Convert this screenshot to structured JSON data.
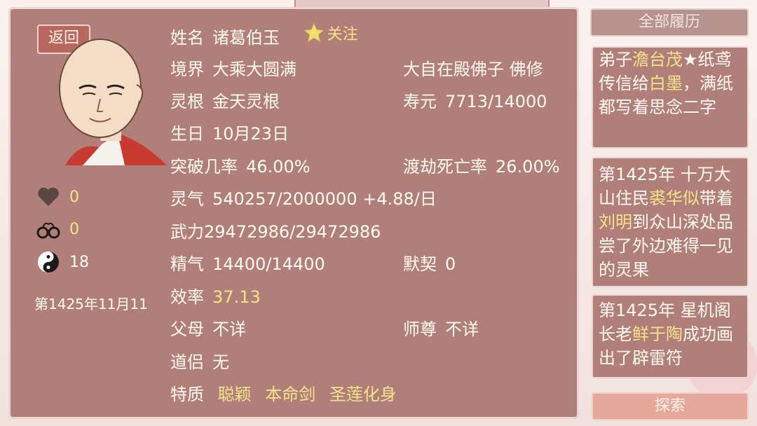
{
  "back_label": "返回",
  "portrait_alt": "",
  "stats": {
    "favor": "0",
    "bond": "0",
    "dao": "18"
  },
  "current_date": "第1425年11月11",
  "info": {
    "name_label": "姓名",
    "name_value": "诸葛伯玉",
    "follow_label": "关注",
    "realm_label": "境界",
    "realm_value": "大乘大圆满",
    "title_value": "大自在殿佛子  佛修",
    "root_label": "灵根",
    "root_value": "金天灵根",
    "lifespan_label": "寿元",
    "lifespan_value": "7713/14000",
    "birthday_label": "生日",
    "birthday_value": "10月23日",
    "breakthrough_label": "突破几率",
    "breakthrough_value": "46.00%",
    "tribulation_label": "渡劫死亡率",
    "tribulation_value": "26.00%",
    "qi_label": "灵气",
    "qi_value": "540257/2000000 +4.88/日",
    "force_label": "武力",
    "force_value": "29472986/29472986",
    "essence_label": "精气",
    "essence_value": "14400/14400",
    "rapport_label": "默契",
    "rapport_value": "0",
    "efficiency_label": "效率",
    "efficiency_value": "37.13",
    "parents_label": "父母",
    "parents_value": "不详",
    "master_label": "师尊",
    "master_value": "不详",
    "partner_label": "道侣",
    "partner_value": "无",
    "traits_label": "特质",
    "traits": [
      "聪颖",
      "本命剑",
      "圣莲化身"
    ]
  },
  "history_button": "全部履历",
  "history": [
    {
      "parts": [
        [
          "弟子",
          false
        ],
        [
          "澹台茂",
          true
        ],
        [
          "★纸鸢传信给",
          false
        ],
        [
          "白墨",
          true
        ],
        [
          "，满纸都写着思念二字",
          false
        ]
      ]
    },
    {
      "parts": [
        [
          "第1425年 十万大山住民",
          false
        ],
        [
          "裘华似",
          true
        ],
        [
          "带着",
          false
        ],
        [
          "刘明",
          true
        ],
        [
          "到众山深处品尝了外边难得一见的灵果",
          false
        ]
      ]
    },
    {
      "parts": [
        [
          "第1425年 星机阁长老",
          false
        ],
        [
          "鲜于陶",
          true
        ],
        [
          "成功画出了辟雷符",
          false
        ]
      ]
    }
  ],
  "explore_button": "探索",
  "colors": {
    "panel": "#b17f79",
    "highlight": "#f4e38b",
    "text": "#fffaf2"
  }
}
